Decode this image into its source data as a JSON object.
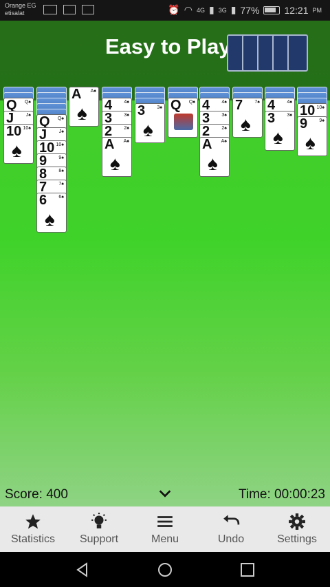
{
  "status_bar": {
    "carrier_1": "Orange EG",
    "carrier_2": "etisalat",
    "net_1": "4G",
    "net_2": "3G",
    "battery": "77%",
    "time": "12:21",
    "ampm": "PM"
  },
  "banner": {
    "title": "Easy to Play"
  },
  "hud": {
    "score_label": "Score: 400",
    "time_label": "Time: 00:00:23"
  },
  "toolbar": {
    "statistics": "Statistics",
    "support": "Support",
    "menu": "Menu",
    "undo": "Undo",
    "settings": "Settings"
  },
  "tableau": [
    {
      "face_down": 2,
      "face_up": [
        "Q",
        "J",
        "10"
      ]
    },
    {
      "face_down": 5,
      "face_up": [
        "Q",
        "J",
        "10",
        "9",
        "8",
        "7",
        "6"
      ]
    },
    {
      "face_down": 0,
      "face_up": [
        "A"
      ]
    },
    {
      "face_down": 2,
      "face_up": [
        "4",
        "3",
        "2",
        "A"
      ]
    },
    {
      "face_down": 3,
      "face_up": [
        "3"
      ]
    },
    {
      "face_down": 2,
      "face_up": [
        "Q"
      ]
    },
    {
      "face_down": 2,
      "face_up": [
        "4",
        "3",
        "2",
        "A"
      ]
    },
    {
      "face_down": 2,
      "face_up": [
        "7"
      ]
    },
    {
      "face_down": 2,
      "face_up": [
        "4",
        "3"
      ]
    },
    {
      "face_down": 3,
      "face_up": [
        "10",
        "9"
      ]
    }
  ],
  "suit_symbol": "♠",
  "colors": {
    "felt": "#3fd32a",
    "card_back": "#4a7ac4",
    "toolbar_bg": "#e9e9e9"
  }
}
